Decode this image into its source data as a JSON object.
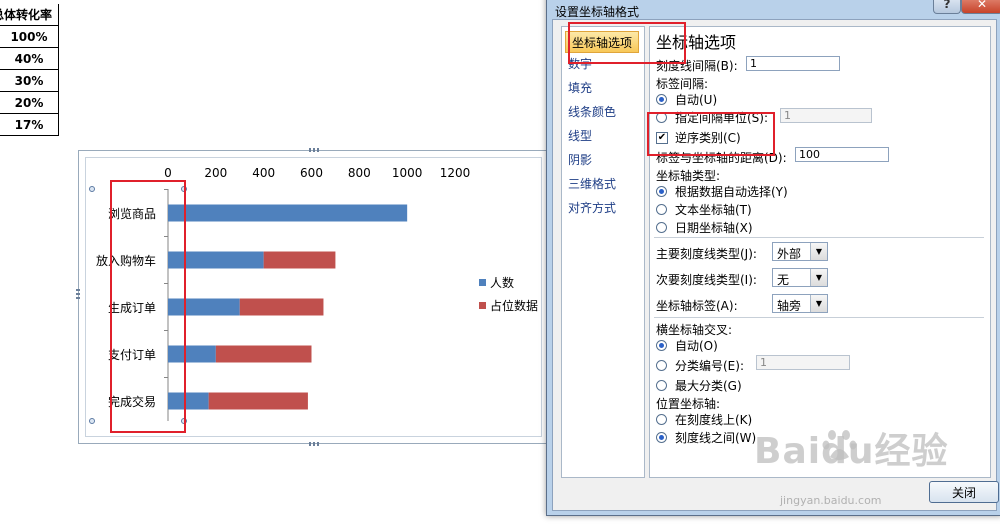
{
  "sheet": {
    "header": "总体转化率",
    "rows": [
      "100%",
      "40%",
      "30%",
      "20%",
      "17%"
    ]
  },
  "chart_data": {
    "type": "bar",
    "orientation": "horizontal",
    "stacked": true,
    "categories": [
      "浏览商品",
      "放入购物车",
      "生成订单",
      "支付订单",
      "完成交易"
    ],
    "x_ticks": [
      "0",
      "200",
      "400",
      "600",
      "800",
      "1000",
      "1200"
    ],
    "xlim": [
      0,
      1200
    ],
    "series": [
      {
        "name": "人数",
        "color": "#4f81bd",
        "values": [
          1000,
          400,
          300,
          200,
          170
        ]
      },
      {
        "name": "占位数据",
        "color": "#c0504d",
        "values": [
          0,
          300,
          350,
          400,
          415
        ]
      }
    ],
    "legend": "right"
  },
  "dialog": {
    "title": "设置坐标轴格式",
    "help": "?",
    "close_x": "✕",
    "nav": [
      "坐标轴选项",
      "数字",
      "填充",
      "线条颜色",
      "线型",
      "阴影",
      "三维格式",
      "对齐方式"
    ],
    "panel_title": "坐标轴选项",
    "tick_interval_label": "刻度线间隔(B):",
    "tick_interval_value": "1",
    "label_interval_label": "标签间隔:",
    "auto_label": "自动(U)",
    "specify_label": "指定间隔单位(S):",
    "specify_value": "1",
    "reverse_label": "逆序类别(C)",
    "distance_label": "标签与坐标轴的距离(D):",
    "distance_value": "100",
    "axis_type_label": "坐标轴类型:",
    "axis_type_options": [
      "根据数据自动选择(Y)",
      "文本坐标轴(T)",
      "日期坐标轴(X)"
    ],
    "major_tick_label": "主要刻度线类型(J):",
    "major_tick_value": "外部",
    "minor_tick_label": "次要刻度线类型(I):",
    "minor_tick_value": "无",
    "axis_labels_label": "坐标轴标签(A):",
    "axis_labels_value": "轴旁",
    "crosses_label": "横坐标轴交叉:",
    "crosses_options": [
      "自动(O)",
      "分类编号(E):",
      "最大分类(G)"
    ],
    "crosses_value": "1",
    "position_label": "位置坐标轴:",
    "position_options": [
      "在刻度线上(K)",
      "刻度线之间(W)"
    ],
    "close_button": "关闭"
  },
  "watermark": {
    "main": "Baidu经验",
    "sub": "jingyan.baidu.com"
  }
}
